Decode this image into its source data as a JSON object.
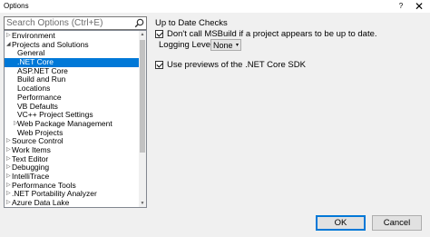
{
  "window": {
    "title": "Options",
    "help_glyph": "?",
    "close_glyph": "✕"
  },
  "search": {
    "placeholder": "Search Options (Ctrl+E)",
    "icon": "search-icon"
  },
  "tree": {
    "items": [
      {
        "label": "Environment",
        "level": 0,
        "arrow": "▷",
        "selected": false
      },
      {
        "label": "Projects and Solutions",
        "level": 0,
        "arrow": "◢",
        "selected": false
      },
      {
        "label": "General",
        "level": 1,
        "arrow": "",
        "selected": false
      },
      {
        "label": ".NET Core",
        "level": 1,
        "arrow": "",
        "selected": true
      },
      {
        "label": "ASP.NET Core",
        "level": 1,
        "arrow": "",
        "selected": false
      },
      {
        "label": "Build and Run",
        "level": 1,
        "arrow": "",
        "selected": false
      },
      {
        "label": "Locations",
        "level": 1,
        "arrow": "",
        "selected": false
      },
      {
        "label": "Performance",
        "level": 1,
        "arrow": "",
        "selected": false
      },
      {
        "label": "VB Defaults",
        "level": 1,
        "arrow": "",
        "selected": false
      },
      {
        "label": "VC++ Project Settings",
        "level": 1,
        "arrow": "",
        "selected": false
      },
      {
        "label": "Web Package Management",
        "level": 1,
        "arrow": "▷",
        "selected": false
      },
      {
        "label": "Web Projects",
        "level": 1,
        "arrow": "",
        "selected": false
      },
      {
        "label": "Source Control",
        "level": 0,
        "arrow": "▷",
        "selected": false
      },
      {
        "label": "Work Items",
        "level": 0,
        "arrow": "▷",
        "selected": false
      },
      {
        "label": "Text Editor",
        "level": 0,
        "arrow": "▷",
        "selected": false
      },
      {
        "label": "Debugging",
        "level": 0,
        "arrow": "▷",
        "selected": false
      },
      {
        "label": "IntelliTrace",
        "level": 0,
        "arrow": "▷",
        "selected": false
      },
      {
        "label": "Performance Tools",
        "level": 0,
        "arrow": "▷",
        "selected": false
      },
      {
        "label": ".NET Portability Analyzer",
        "level": 0,
        "arrow": "▷",
        "selected": false
      },
      {
        "label": "Azure Data Lake",
        "level": 0,
        "arrow": "▷",
        "selected": false
      }
    ],
    "scroll_up": "▲",
    "scroll_down": "▼"
  },
  "panel": {
    "section_title": "Up to Date Checks",
    "dont_call_msbuild": {
      "label": "Don't call MSBuild if a project appears to be up to date.",
      "checked": true
    },
    "logging_level": {
      "label": "Logging Level:",
      "value": "None",
      "chevron": "▾"
    },
    "use_previews": {
      "label": "Use previews of the .NET Core SDK",
      "checked": true
    }
  },
  "footer": {
    "ok_label": "OK",
    "cancel_label": "Cancel"
  },
  "colors": {
    "selection": "#0078d7",
    "background": "#f0f0f0"
  }
}
